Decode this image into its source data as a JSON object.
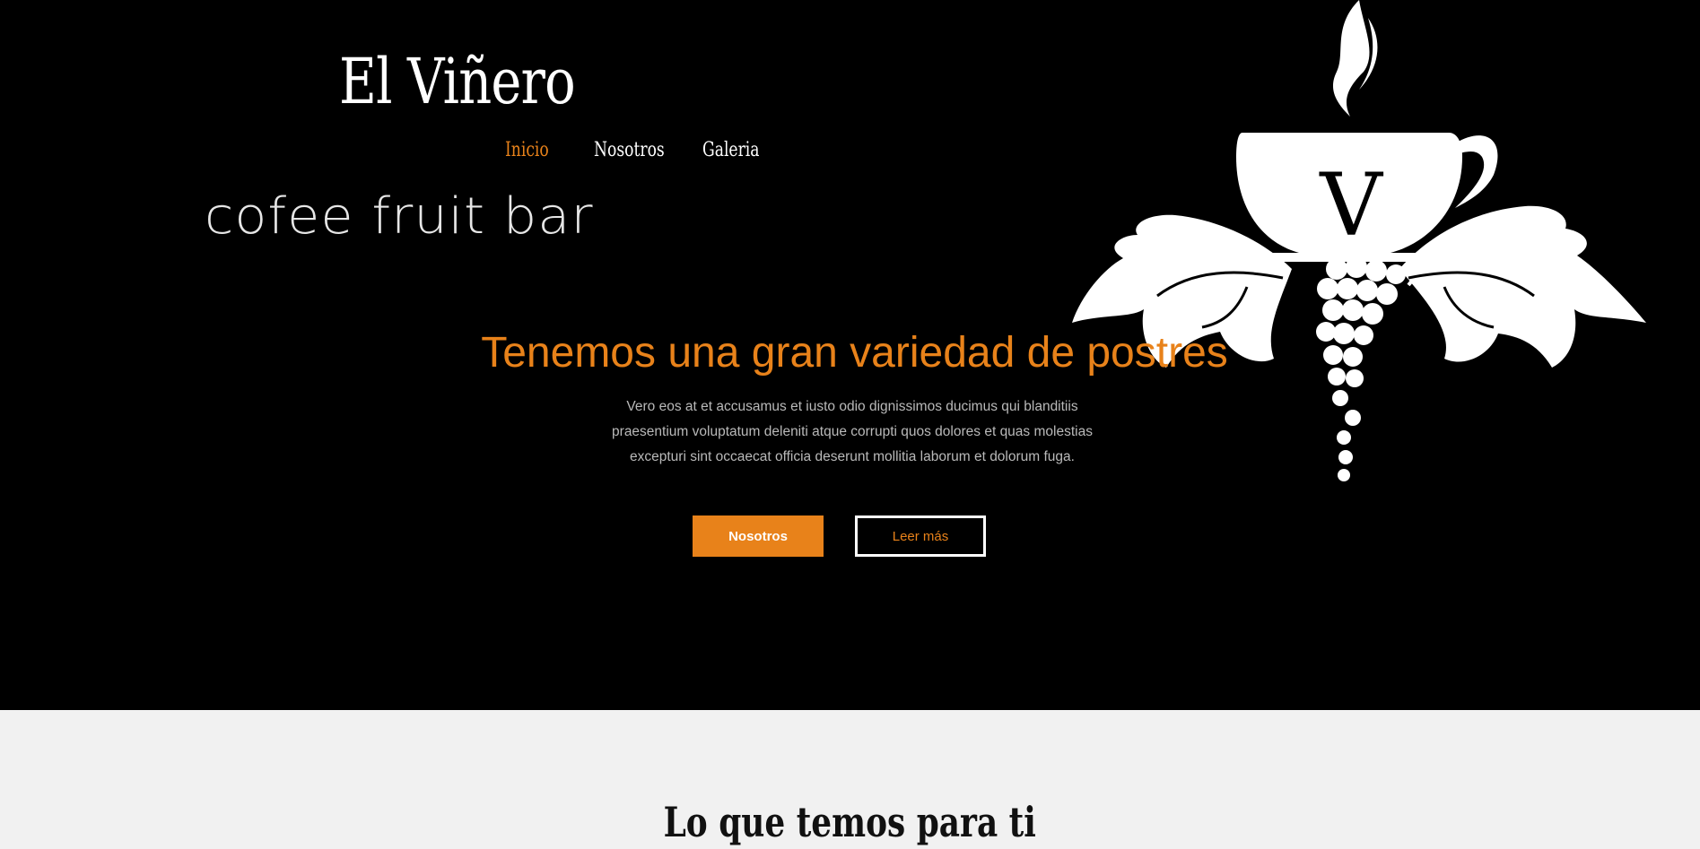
{
  "brand": {
    "title": "El Viñero",
    "subtitle": "cofee fruit bar",
    "logo_letter": "V"
  },
  "nav": {
    "items": [
      {
        "label": "Inicio",
        "active": true
      },
      {
        "label": "Nosotros",
        "active": false
      },
      {
        "label": "Galeria",
        "active": false
      }
    ]
  },
  "hero": {
    "headline": "Tenemos una gran variedad de postres",
    "description": "Vero eos at et accusamus et iusto odio dignissimos ducimus qui blanditiis praesentium voluptatum deleniti atque corrupti quos dolores et quas molestias excepturi sint occaecat officia deserunt mollitia laborum et dolorum fuga.",
    "primary_button": "Nosotros",
    "secondary_button": "Leer más"
  },
  "section": {
    "title": "Lo que temos para ti"
  },
  "colors": {
    "accent": "#e8821a",
    "background": "#000000",
    "section_bg": "#f1f1f1"
  },
  "icons": {
    "logo": "coffee-cup-grape-leaves-logo"
  }
}
